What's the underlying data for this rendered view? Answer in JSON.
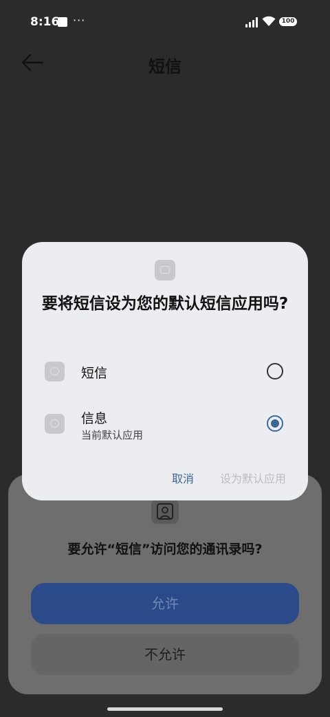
{
  "status_bar": {
    "time": "8:16",
    "dots": "···",
    "battery": "100"
  },
  "header": {
    "title": "短信"
  },
  "dialog": {
    "title": "要将短信设为您的默认短信应用吗?",
    "options": [
      {
        "label": "短信",
        "sublabel": "",
        "selected": false
      },
      {
        "label": "信息",
        "sublabel": "当前默认应用",
        "selected": true
      }
    ],
    "cancel_label": "取消",
    "set_default_label": "设为默认应用"
  },
  "permission_sheet": {
    "title": "要允许“短信”访问您的通讯录吗?",
    "allow_label": "允许",
    "deny_label": "不允许"
  },
  "colors": {
    "background": "#2b2b2b",
    "dialog_background": "#ebedf1",
    "accent": "#3b6796",
    "allow_button": "#2a4a8a"
  }
}
